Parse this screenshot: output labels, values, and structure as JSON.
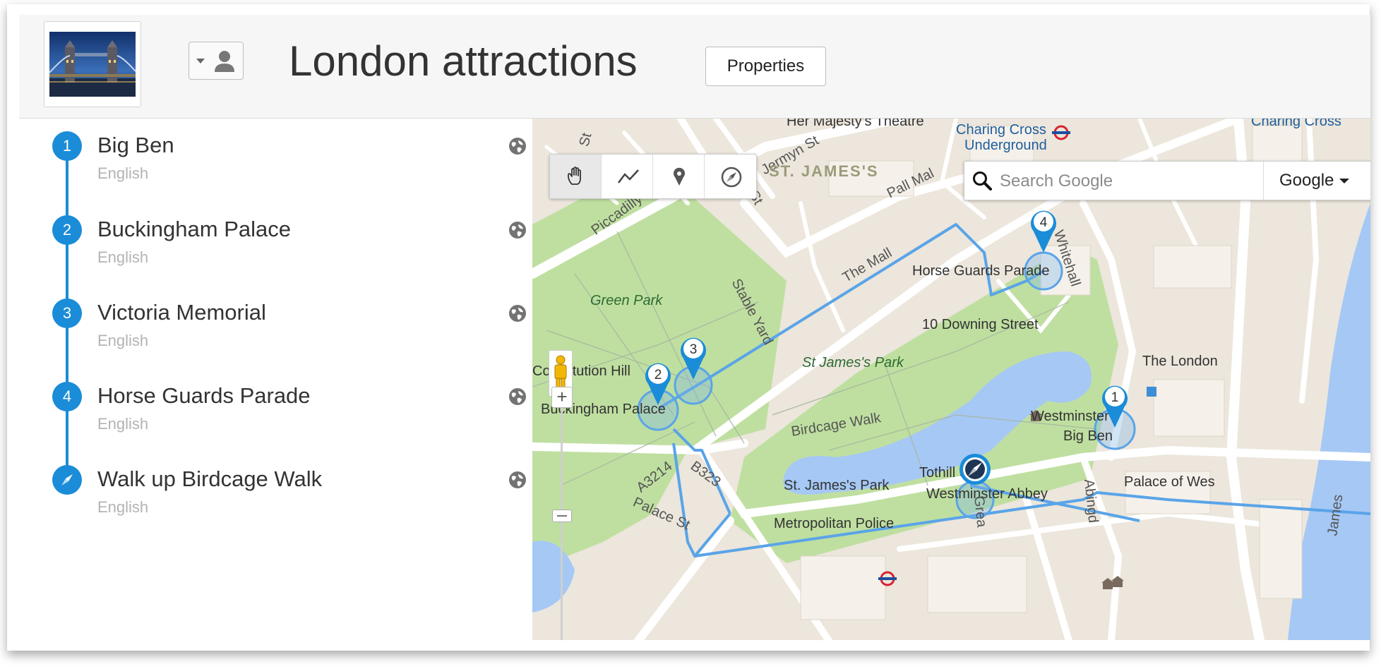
{
  "header": {
    "title": "London attractions",
    "properties_label": "Properties",
    "thumbnail_icon": "tower-bridge-photo",
    "owner_icon": "person-icon"
  },
  "stops": [
    {
      "number": "1",
      "name": "Big Ben",
      "language": "English",
      "marker": "numbered"
    },
    {
      "number": "2",
      "name": "Buckingham Palace",
      "language": "English",
      "marker": "numbered"
    },
    {
      "number": "3",
      "name": "Victoria Memorial",
      "language": "English",
      "marker": "numbered"
    },
    {
      "number": "4",
      "name": "Horse Guards Parade",
      "language": "English",
      "marker": "numbered"
    },
    {
      "number": "",
      "name": "Walk up Birdcage Walk",
      "language": "English",
      "marker": "compass-icon"
    }
  ],
  "map": {
    "search_placeholder": "Search Google",
    "search_engine": "Google",
    "tools": [
      "hand-icon",
      "line-icon",
      "pin-icon",
      "compass-icon"
    ],
    "markers": [
      "1",
      "2",
      "3",
      "4"
    ],
    "labels": {
      "her_majestys": "Her Majesty's Theatre",
      "charing_cross_ug": "Charing Cross",
      "underground": "Underground",
      "charing_cross": "Charing Cross",
      "jermyn": "Jermyn St",
      "bury": "Bury St",
      "st_james": "ST. JAMES'S",
      "pall_mall": "Pall Mal",
      "piccadilly": "Piccadilly",
      "green_park": "Green Park",
      "stable_yard": "Stable Yard",
      "the_mall": "The Mall",
      "horse_guards": "Horse Guards Parade",
      "whitehall": "Whitehall",
      "downing": "10 Downing Street",
      "st_james_park": "St James's Park",
      "constitution": "Constitution Hill",
      "buckingham": "Buckingham Palace",
      "birdcage": "Birdcage Walk",
      "westminster": "Westminster",
      "big_ben": "Big Ben",
      "the_london": "The London",
      "a3214": "A3214",
      "b323": "B323",
      "st_james_station": "St. James's Park",
      "tothill": "Tothill St",
      "westminster_abbey": "Westminster Abbey",
      "palace_of_west": "Palace of Wes",
      "palace_st": "Palace St",
      "metropolitan": "Metropolitan Police",
      "great": "Grea",
      "abing": "Abingd",
      "james": "James",
      "st": "St"
    }
  },
  "colors": {
    "accent": "#1a8cd8",
    "route": "#5aa4e8",
    "park": "#bfdfa0",
    "water": "#a5c8f5",
    "road": "#ffffff",
    "land": "#ece6dc"
  }
}
